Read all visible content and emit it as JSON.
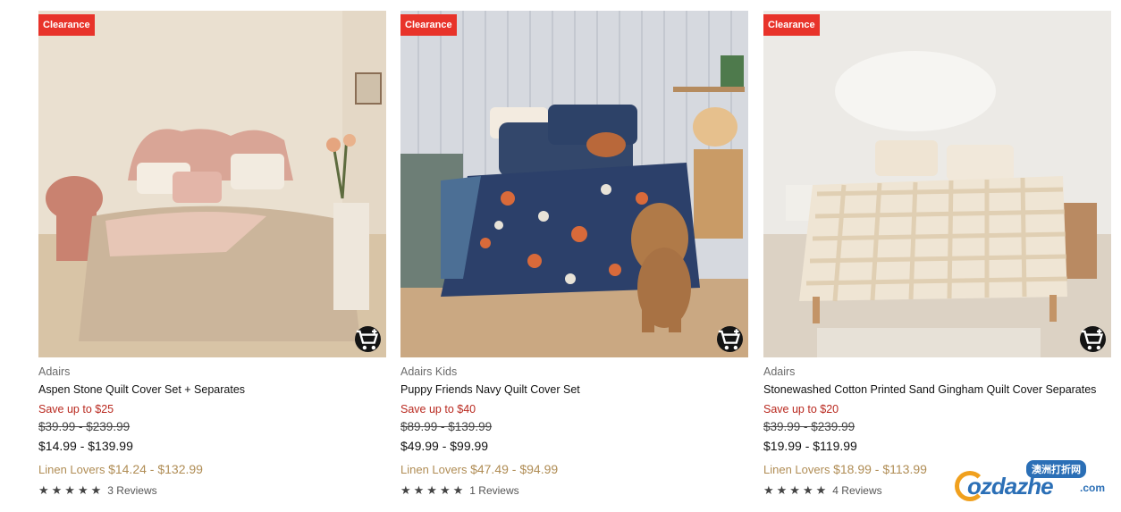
{
  "products": [
    {
      "badge": "Clearance",
      "brand": "Adairs",
      "name": "Aspen Stone Quilt Cover Set + Separates",
      "save": "Save up to $25",
      "was": "$39.99 - $239.99",
      "now": "$14.99 - $139.99",
      "linen_label": "Linen Lovers",
      "linen_price": "$14.24 - $132.99",
      "stars": "★★★★★",
      "reviews": "3 Reviews",
      "image_icon": "bedroom-photo-beige-quilt"
    },
    {
      "badge": "Clearance",
      "brand": "Adairs Kids",
      "name": "Puppy Friends Navy Quilt Cover Set",
      "save": "Save up to $40",
      "was": "$89.99 - $139.99",
      "now": "$49.99 - $99.99",
      "linen_label": "Linen Lovers",
      "linen_price": "$47.49 - $94.99",
      "stars": "★★★★★",
      "reviews": "1 Reviews",
      "image_icon": "bedroom-photo-navy-puppy-quilt"
    },
    {
      "badge": "Clearance",
      "brand": "Adairs",
      "name": "Stonewashed Cotton Printed Sand Gingham Quilt Cover Separates",
      "save": "Save up to $20",
      "was": "$39.99 - $239.99",
      "now": "$19.99 - $119.99",
      "linen_label": "Linen Lovers",
      "linen_price": "$18.99 - $113.99",
      "stars": "★★★★★",
      "reviews": "4 Reviews",
      "image_icon": "bedroom-photo-gingham-quilt"
    }
  ],
  "watermark": {
    "pill": "澳洲打折网",
    "text": "ozdazhe",
    "domain": ".com"
  },
  "colors": {
    "badge": "#e8332a",
    "save": "#b9291f",
    "linen": "#b08d55",
    "cart_button": "#141414"
  }
}
